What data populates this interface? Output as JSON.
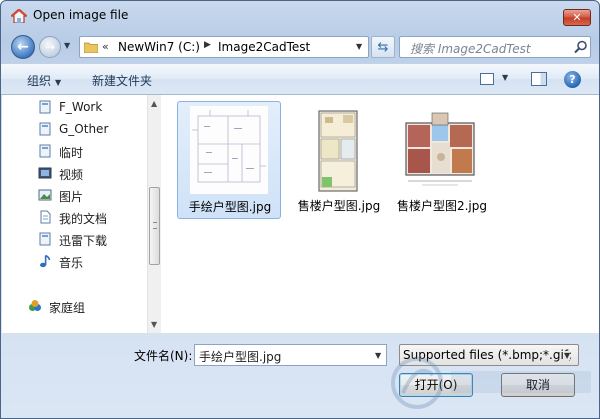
{
  "window": {
    "title": "Open image file",
    "close_glyph": "✕"
  },
  "nav": {
    "back_glyph": "←",
    "forward_glyph": "→",
    "address_overflow": "«",
    "path": [
      "NewWin7 (C:)",
      "Image2CadTest"
    ],
    "refresh_glyph": "⇆",
    "search_placeholder": "搜索 Image2CadTest"
  },
  "toolbar": {
    "organize_label": "组织",
    "new_folder_label": "新建文件夹",
    "help_glyph": "?"
  },
  "sidebar": {
    "items": [
      {
        "label": "F_Work",
        "icon": "library-icon"
      },
      {
        "label": "G_Other",
        "icon": "library-icon"
      },
      {
        "label": "临时",
        "icon": "library-icon"
      },
      {
        "label": "视频",
        "icon": "video-library-icon"
      },
      {
        "label": "图片",
        "icon": "picture-library-icon"
      },
      {
        "label": "我的文档",
        "icon": "document-library-icon"
      },
      {
        "label": "迅雷下载",
        "icon": "library-icon"
      },
      {
        "label": "音乐",
        "icon": "music-icon"
      },
      {
        "label": "家庭组",
        "icon": "homegroup-icon"
      }
    ],
    "scrollbar": {
      "up_glyph": "▲",
      "down_glyph": "▼"
    }
  },
  "files": [
    {
      "name": "手绘户型图.jpg",
      "selected": true
    },
    {
      "name": "售楼户型图.jpg",
      "selected": false
    },
    {
      "name": "售楼户型图2.jpg",
      "selected": false
    }
  ],
  "bottom": {
    "filename_label": "文件名(N):",
    "filename_value": "手绘户型图.jpg",
    "filetype_value": "Supported files (*.bmp;*.gif;",
    "open_label": "打开(O)",
    "cancel_label": "取消"
  },
  "colors": {
    "titlebar": "#c9d9ee",
    "selection": "#cfe2f8",
    "close": "#c23b25"
  }
}
